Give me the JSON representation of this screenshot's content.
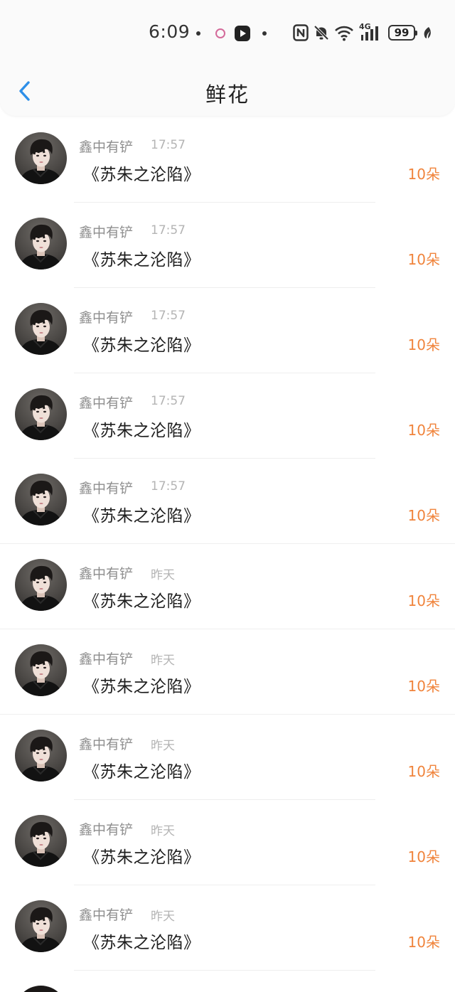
{
  "status_bar": {
    "time": "6:09",
    "network": "4G",
    "battery": "99"
  },
  "header": {
    "title": "鲜花",
    "back_icon": "chevron-left-icon"
  },
  "colors": {
    "accent_blue": "#2e8fe8",
    "amount_orange": "#f0843c",
    "username_gray": "#8e8e8e",
    "time_gray": "#b4b4b4"
  },
  "gifts": [
    {
      "user": "鑫中有铲",
      "time": "17:57",
      "book": "《苏朱之沦陷》",
      "amount": "10朵"
    },
    {
      "user": "鑫中有铲",
      "time": "17:57",
      "book": "《苏朱之沦陷》",
      "amount": "10朵"
    },
    {
      "user": "鑫中有铲",
      "time": "17:57",
      "book": "《苏朱之沦陷》",
      "amount": "10朵"
    },
    {
      "user": "鑫中有铲",
      "time": "17:57",
      "book": "《苏朱之沦陷》",
      "amount": "10朵"
    },
    {
      "user": "鑫中有铲",
      "time": "17:57",
      "book": "《苏朱之沦陷》",
      "amount": "10朵"
    },
    {
      "user": "鑫中有铲",
      "time": "昨天",
      "book": "《苏朱之沦陷》",
      "amount": "10朵"
    },
    {
      "user": "鑫中有铲",
      "time": "昨天",
      "book": "《苏朱之沦陷》",
      "amount": "10朵"
    },
    {
      "user": "鑫中有铲",
      "time": "昨天",
      "book": "《苏朱之沦陷》",
      "amount": "10朵"
    },
    {
      "user": "鑫中有铲",
      "time": "昨天",
      "book": "《苏朱之沦陷》",
      "amount": "10朵"
    },
    {
      "user": "鑫中有铲",
      "time": "昨天",
      "book": "《苏朱之沦陷》",
      "amount": "10朵"
    }
  ]
}
